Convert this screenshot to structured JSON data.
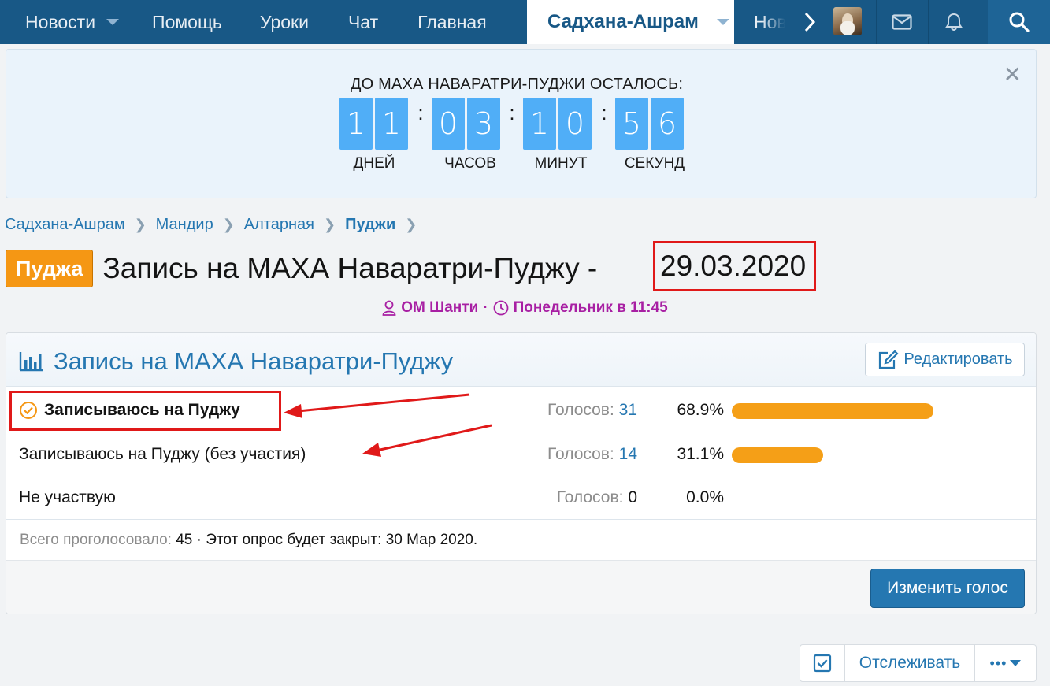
{
  "nav": {
    "items": [
      {
        "label": "Новости"
      },
      {
        "label": "Помощь"
      },
      {
        "label": "Уроки"
      },
      {
        "label": "Чат"
      },
      {
        "label": "Главная"
      }
    ],
    "active": "Садхана-Ашрам",
    "truncated": "Нов",
    "icons": [
      "chevron-right-icon",
      "avatar",
      "mail-icon",
      "bell-icon",
      "search-icon"
    ]
  },
  "notice": {
    "title": "ДО МАХА НАВАРАТРИ-ПУДЖИ ОСТАЛОСЬ:",
    "close": "✕",
    "days_digits": [
      "1",
      "1"
    ],
    "hours_digits": [
      "0",
      "3"
    ],
    "minutes_digits": [
      "1",
      "0"
    ],
    "seconds_digits": [
      "5",
      "6"
    ],
    "separator": ":",
    "days_label": "ДНЕЙ",
    "hours_label": "ЧАСОВ",
    "minutes_label": "МИНУТ",
    "seconds_label": "СЕКУНД"
  },
  "breadcrumb": [
    "Садхана-Ашрам",
    "Мандир",
    "Алтарная",
    "Пуджи"
  ],
  "thread": {
    "prefix": "Пуджа",
    "title": "Запись на МАХА Наваратри-Пуджу -",
    "date": "29.03.2020",
    "author": "ОМ Шанти",
    "dot": "·",
    "time": "Понедельник в 11:45"
  },
  "poll": {
    "title": "Запись на МАХА Наваратри-Пуджу",
    "edit_label": "Редактировать",
    "votes_label": "Голосов:",
    "options": [
      {
        "text": "Записываюсь на Пуджу",
        "votes": "31",
        "percent": "68.9%",
        "fraction": 0.689,
        "selected": true
      },
      {
        "text": "Записываюсь на Пуджу (без участия)",
        "votes": "14",
        "percent": "31.1%",
        "fraction": 0.311,
        "selected": false
      },
      {
        "text": "Не участвую",
        "votes": "0",
        "percent": "0.0%",
        "fraction": 0.0,
        "selected": false
      }
    ],
    "summary_label": "Всего проголосовало:",
    "summary_total": "45",
    "summary_close": "· Этот опрос будет закрыт: 30 Мар 2020.",
    "change_vote_label": "Изменить голос"
  },
  "bottom": {
    "watch_label": "Отслеживать",
    "more_label": "•••"
  },
  "colors": {
    "nav_bg": "#185886",
    "accent": "#2577b1",
    "badge": "#f59714",
    "bar": "#f59f17",
    "digit_bg": "#50aef7",
    "meta": "#a81fa3",
    "annotation": "#e01919"
  }
}
